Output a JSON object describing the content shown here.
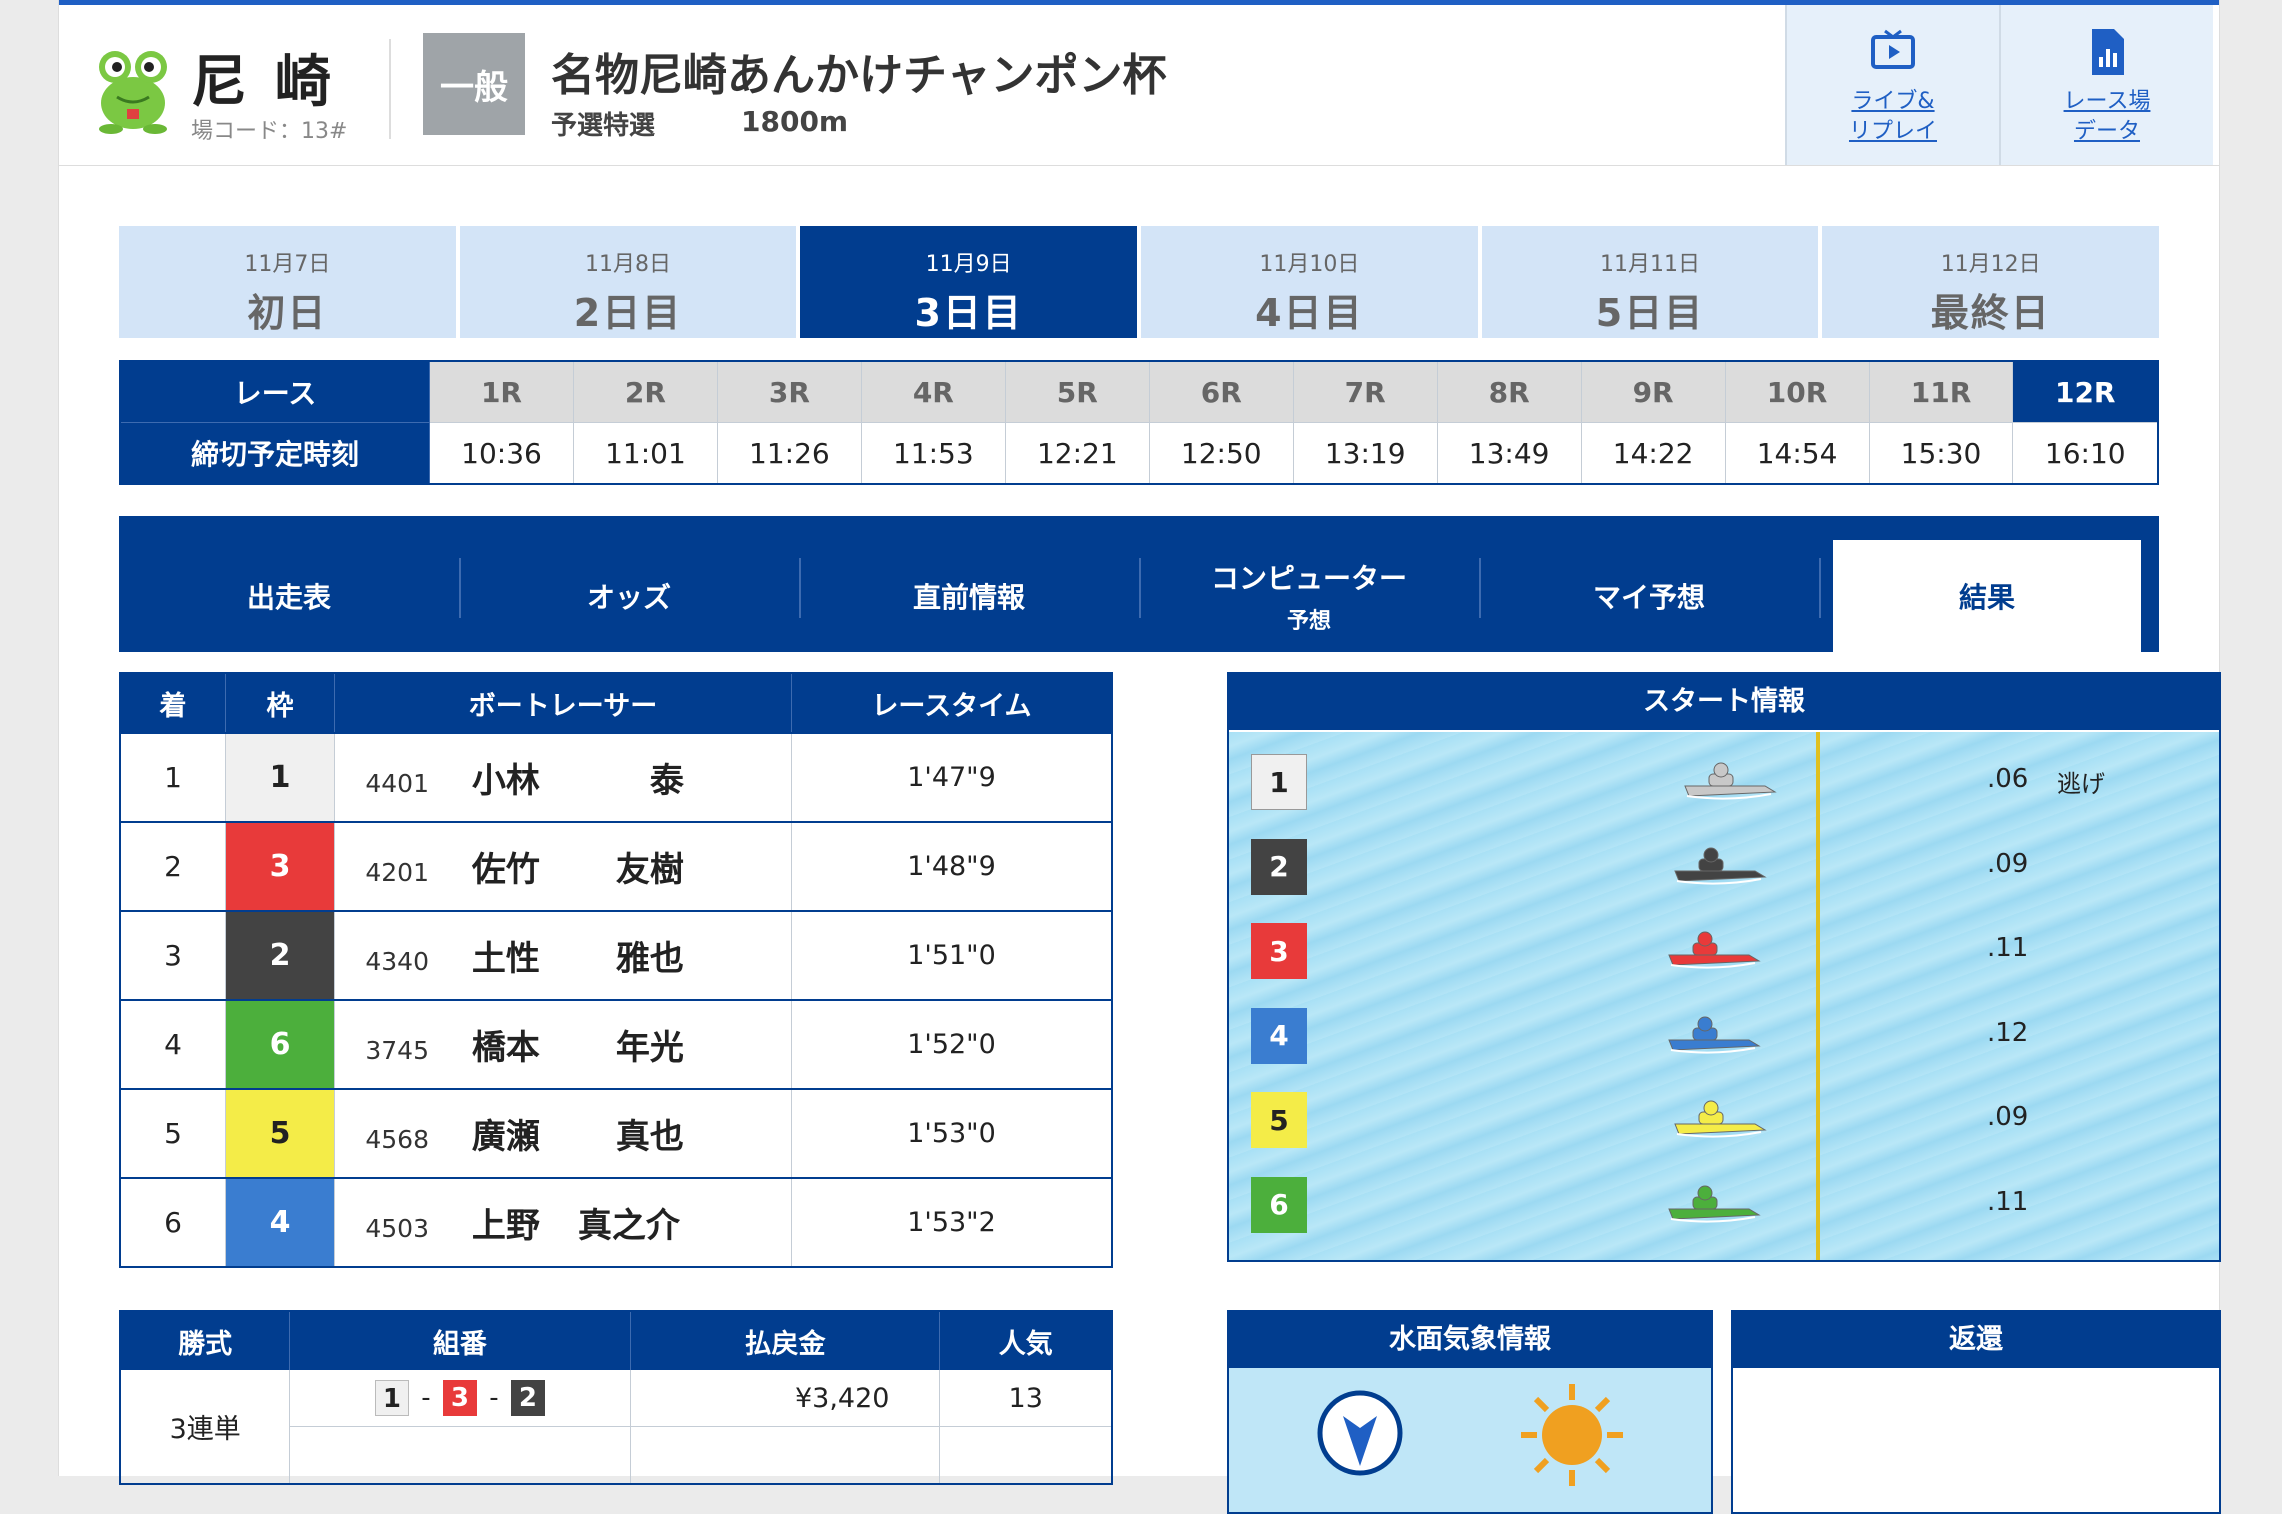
{
  "header": {
    "venue": "尼崎",
    "venue_code": "場コード：13#",
    "grade": "一般",
    "race_title": "名物尼崎あんかけチャンポン杯",
    "race_subtitle": "予選特選",
    "distance": "1800m",
    "buttons": [
      {
        "label_line1": "ライブ&",
        "label_line2": "リプレイ",
        "icon": "tv-play-icon"
      },
      {
        "label_line1": "レース場",
        "label_line2": "データ",
        "icon": "bar-chart-document-icon"
      }
    ]
  },
  "days": [
    {
      "date": "11月7日",
      "label": "初日"
    },
    {
      "date": "11月8日",
      "label": "2日目"
    },
    {
      "date": "11月9日",
      "label": "3日目",
      "active": true
    },
    {
      "date": "11月10日",
      "label": "4日目"
    },
    {
      "date": "11月11日",
      "label": "5日目"
    },
    {
      "date": "11月12日",
      "label": "最終日"
    }
  ],
  "race_table": {
    "race_header": "レース",
    "deadline_header": "締切予定時刻",
    "races": [
      "1R",
      "2R",
      "3R",
      "4R",
      "5R",
      "6R",
      "7R",
      "8R",
      "9R",
      "10R",
      "11R",
      "12R"
    ],
    "deadlines": [
      "10:36",
      "11:01",
      "11:26",
      "11:53",
      "12:21",
      "12:50",
      "13:19",
      "13:49",
      "14:22",
      "14:54",
      "15:30",
      "16:10"
    ],
    "active_race": "12R"
  },
  "nav": [
    {
      "label": "出走表"
    },
    {
      "label": "オッズ"
    },
    {
      "label": "直前情報"
    },
    {
      "label": "コンピューター",
      "sub": "予想"
    },
    {
      "label": "マイ予想"
    },
    {
      "label": "結果",
      "active": true
    }
  ],
  "results": {
    "headers": [
      "着",
      "枠",
      "ボートレーサー",
      "レースタイム"
    ],
    "rows": [
      {
        "rank": "1",
        "waku": "1",
        "reg": "4401",
        "family": "小林",
        "given": "泰",
        "time": "1'47\"9"
      },
      {
        "rank": "2",
        "waku": "3",
        "reg": "4201",
        "family": "佐竹",
        "given": "友樹",
        "time": "1'48\"9"
      },
      {
        "rank": "3",
        "waku": "2",
        "reg": "4340",
        "family": "土性",
        "given": "雅也",
        "time": "1'51\"0"
      },
      {
        "rank": "4",
        "waku": "6",
        "reg": "3745",
        "family": "橋本",
        "given": "年光",
        "time": "1'52\"0"
      },
      {
        "rank": "5",
        "waku": "5",
        "reg": "4568",
        "family": "廣瀬",
        "given": "真也",
        "time": "1'53\"0"
      },
      {
        "rank": "6",
        "waku": "4",
        "reg": "4503",
        "family": "上野",
        "given": "真之介",
        "time": "1'53\"2"
      }
    ]
  },
  "start_info": {
    "title": "スタート情報",
    "rows": [
      {
        "course": "1",
        "st": ".06",
        "kimarite": "逃げ",
        "color": "#f0f0f0"
      },
      {
        "course": "2",
        "st": ".09",
        "kimarite": "",
        "color": "#434343"
      },
      {
        "course": "3",
        "st": ".11",
        "kimarite": "",
        "color": "#e83a3a"
      },
      {
        "course": "4",
        "st": ".12",
        "kimarite": "",
        "color": "#3a7dd0"
      },
      {
        "course": "5",
        "st": ".09",
        "kimarite": "",
        "color": "#f4ec48"
      },
      {
        "course": "6",
        "st": ".11",
        "kimarite": "",
        "color": "#4caf3c"
      }
    ]
  },
  "payout": {
    "headers": [
      "勝式",
      "組番",
      "払戻金",
      "人気"
    ],
    "kind": "3連単",
    "combo": [
      "1",
      "3",
      "2"
    ],
    "amount": "¥3,420",
    "popularity": "13"
  },
  "weather": {
    "title": "水面気象情報"
  },
  "henkan": {
    "title": "返還"
  },
  "colors": {
    "navy": "#013d8f",
    "accent_blue": "#1f5fc4",
    "day_bg": "#d3e4f7"
  }
}
